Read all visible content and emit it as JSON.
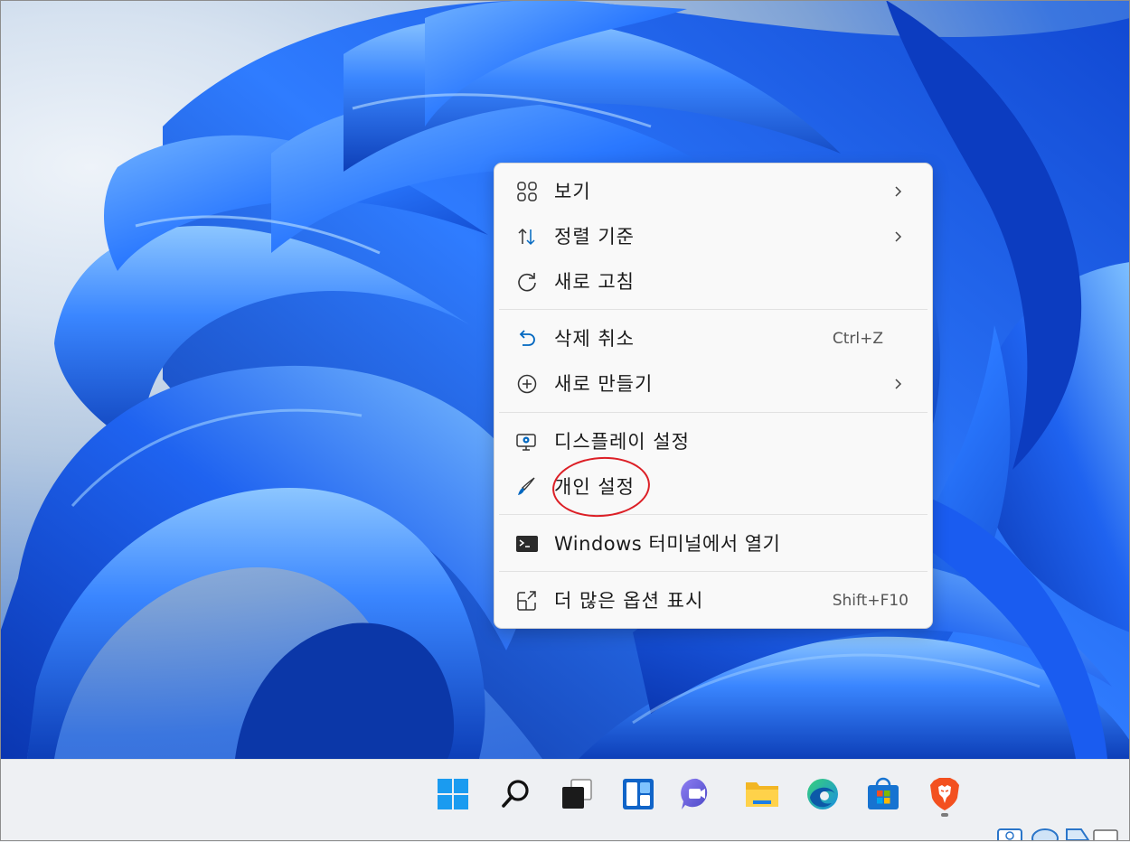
{
  "context_menu": {
    "items": [
      {
        "label": "보기",
        "icon": "view-grid-icon",
        "submenu": true
      },
      {
        "label": "정렬 기준",
        "icon": "sort-arrows-icon",
        "submenu": true
      },
      {
        "label": "새로 고침",
        "icon": "refresh-icon"
      },
      {
        "label": "삭제 취소",
        "icon": "undo-icon",
        "shortcut": "Ctrl+Z"
      },
      {
        "label": "새로 만들기",
        "icon": "add-circle-icon",
        "submenu": true
      },
      {
        "label": "디스플레이 설정",
        "icon": "display-settings-icon"
      },
      {
        "label": "개인 설정",
        "icon": "brush-icon",
        "highlighted": true
      },
      {
        "label": "Windows 터미널에서 열기",
        "icon": "terminal-icon"
      },
      {
        "label": "더 많은 옵션 표시",
        "icon": "more-options-icon",
        "shortcut": "Shift+F10"
      }
    ]
  },
  "taskbar": {
    "items": [
      "start-icon",
      "search-icon",
      "task-view-icon",
      "widgets-icon",
      "teams-chat-icon",
      "file-explorer-icon",
      "edge-icon",
      "store-icon",
      "brave-icon"
    ],
    "active": "brave-icon"
  },
  "colors": {
    "accent": "#0067c0",
    "annotation": "#dc1f26",
    "wallpaper": "#1d55d6"
  }
}
